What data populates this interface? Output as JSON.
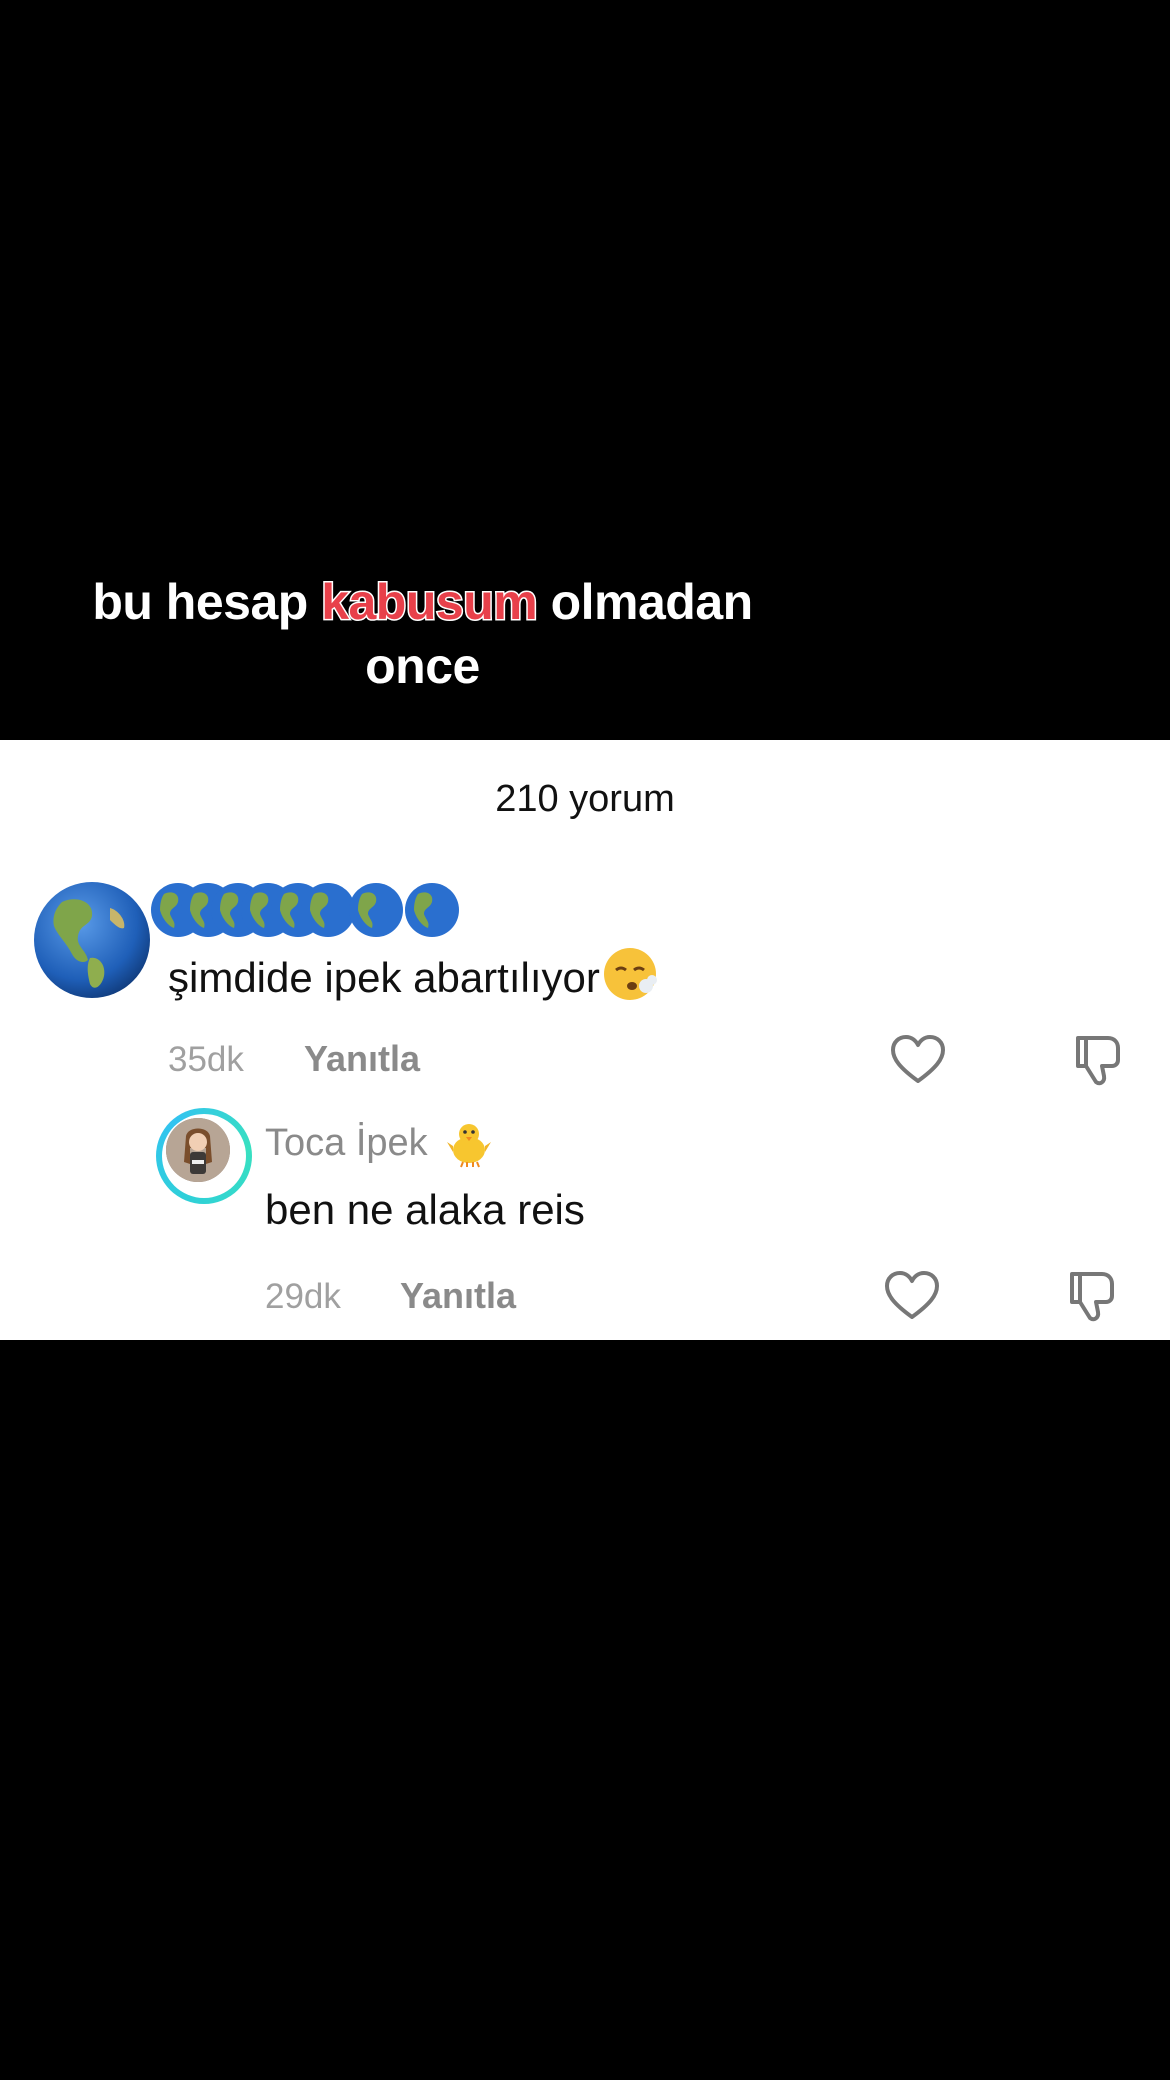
{
  "video": {
    "caption_before": "bu hesap ",
    "caption_highlight": "kabusum",
    "caption_after": " olmadan",
    "caption_line2": "once",
    "highlight_color": "#e8404a"
  },
  "comments_panel": {
    "count_label": "210 yorum",
    "comments": [
      {
        "avatar_icon": "earth-americas-icon",
        "username_icons": [
          "earth-icon",
          "earth-icon",
          "earth-icon",
          "earth-icon",
          "earth-icon",
          "earth-icon",
          "earth-icon",
          "earth-icon"
        ],
        "text": "şimdide ipek abartılıyor",
        "text_emoji": "exhale-face-icon",
        "time": "35dk",
        "reply_label": "Yanıtla"
      }
    ],
    "reply": {
      "username": "Toca İpek",
      "username_emoji": "baby-chick-icon",
      "text": "ben ne alaka reis",
      "time": "29dk",
      "reply_label": "Yanıtla",
      "avatar_ring_color": "#2fd0d8"
    }
  }
}
